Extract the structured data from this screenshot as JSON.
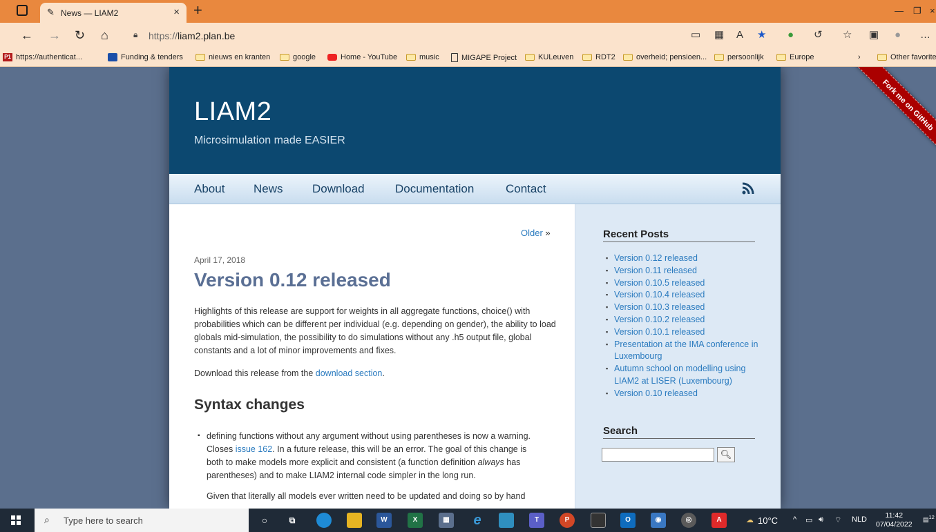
{
  "browser": {
    "tab_title": "News — LIAM2",
    "url_scheme": "https://",
    "url_host": "liam2.plan.be",
    "bookmarks": [
      {
        "label": "https://authenticat...",
        "icon": "p1-icon"
      },
      {
        "label": "Funding & tenders",
        "icon": "eu-icon"
      },
      {
        "label": "nieuws en kranten",
        "icon": "folder-icon"
      },
      {
        "label": "google",
        "icon": "folder-icon"
      },
      {
        "label": "Home - YouTube",
        "icon": "youtube-icon"
      },
      {
        "label": "music",
        "icon": "folder-icon"
      },
      {
        "label": "MIGAPE Project",
        "icon": "page-icon"
      },
      {
        "label": "KULeuven",
        "icon": "folder-icon"
      },
      {
        "label": "RDT2",
        "icon": "folder-icon"
      },
      {
        "label": "overheid; pensioen...",
        "icon": "folder-icon"
      },
      {
        "label": "persoonlijk",
        "icon": "folder-icon"
      },
      {
        "label": "Europe",
        "icon": "folder-icon"
      }
    ],
    "other_favorites": "Other favorite"
  },
  "site": {
    "title": "LIAM2",
    "subtitle": "Microsimulation made EASIER",
    "nav": [
      "About",
      "News",
      "Download",
      "Documentation",
      "Contact"
    ],
    "ribbon": "Fork me on GitHub"
  },
  "post": {
    "older": "Older",
    "date": "April 17, 2018",
    "title": "Version 0.12 released",
    "intro": "Highlights of this release are support for weights in all aggregate functions, choice() with probabilities which can be different per individual (e.g. depending on gender), the ability to load globals mid-simulation, the possibility to do simulations without any .h5 output file, global constants and a lot of minor improvements and fixes.",
    "download_prefix": "Download this release from the ",
    "download_link": "download section",
    "download_suffix": ".",
    "section": "Syntax changes",
    "item1_a": "defining functions without any argument without using parentheses is now a warning. Closes ",
    "item1_link": "issue 162",
    "item1_b": ". In a future release, this will be an error. The goal of this change is both to make models more explicit and consistent (a function definition ",
    "item1_em": "always",
    "item1_c": " has parentheses) and to make LIAM2 internal code simpler in the long run.",
    "item1_p2": "Given that literally all models ever written need to be updated and doing so by hand"
  },
  "sidebar": {
    "recent_heading": "Recent Posts",
    "recent": [
      "Version 0.12 released",
      "Version 0.11 released",
      "Version 0.10.5 released",
      "Version 0.10.4 released",
      "Version 0.10.3 released",
      "Version 0.10.2 released",
      "Version 0.10.1 released",
      "Presentation at the IMA conference in Luxembourg",
      "Autumn school on modelling using LIAM2 at LISER (Luxembourg)",
      "Version 0.10 released"
    ],
    "search_heading": "Search"
  },
  "taskbar": {
    "search_placeholder": "Type here to search",
    "weather": "10°C",
    "language": "NLD",
    "time": "11:42",
    "date": "07/04/2022",
    "notifications": "12"
  }
}
